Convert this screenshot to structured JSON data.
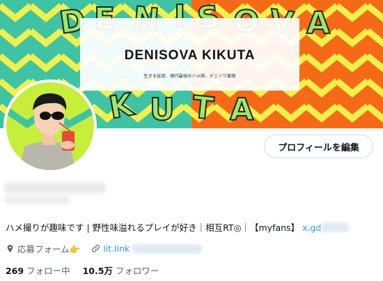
{
  "banner": {
    "title": "DENISOVA KIKUTA",
    "subtitle": "生きる伝説、現代最強のハメ師、デニソワ菊田",
    "bg_colors": [
      "#3fc3a5",
      "#f66a17",
      "#f6f34a",
      "#c7f05a"
    ]
  },
  "avatar": {
    "icon": "profile-avatar-illustration"
  },
  "profile": {
    "edit_button": "プロフィールを編集",
    "bio_text": "ハメ撮りが趣味です | 野性味溢れるプレイが好き｜相互RT◎｜【myfans】",
    "bio_link": "x.gd",
    "location": "応募フォーム👉",
    "website": "lit.link",
    "following_count": "269",
    "following_label": "フォロー中",
    "followers_count": "10.5万",
    "followers_label": "フォロワー"
  },
  "colors": {
    "link": "#1d9bf0",
    "muted": "#536471",
    "text": "#0f1419"
  }
}
